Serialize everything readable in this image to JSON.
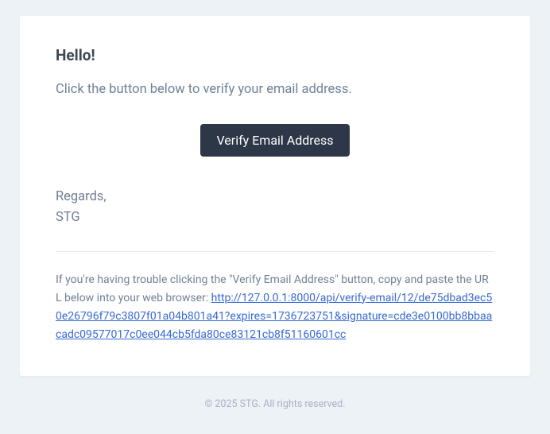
{
  "greeting": "Hello!",
  "instruction": "Click the button below to verify your email address.",
  "button_label": "Verify Email Address",
  "regards_line1": "Regards,",
  "regards_line2": "STG",
  "trouble_prefix": "If you're having trouble clicking the \"Verify Email Address\" button, copy and paste the URL below into your web browser: ",
  "verify_url": "http://127.0.0.1:8000/api/verify-email/12/de75dbad3ec50e26796f79c3807f01a04b801a41?expires=1736723751&signature=cde3e0100bb8bbaacadc09577017c0ee044cb5fda80ce83121cb8f51160601cc",
  "footer": "© 2025 STG. All rights reserved."
}
